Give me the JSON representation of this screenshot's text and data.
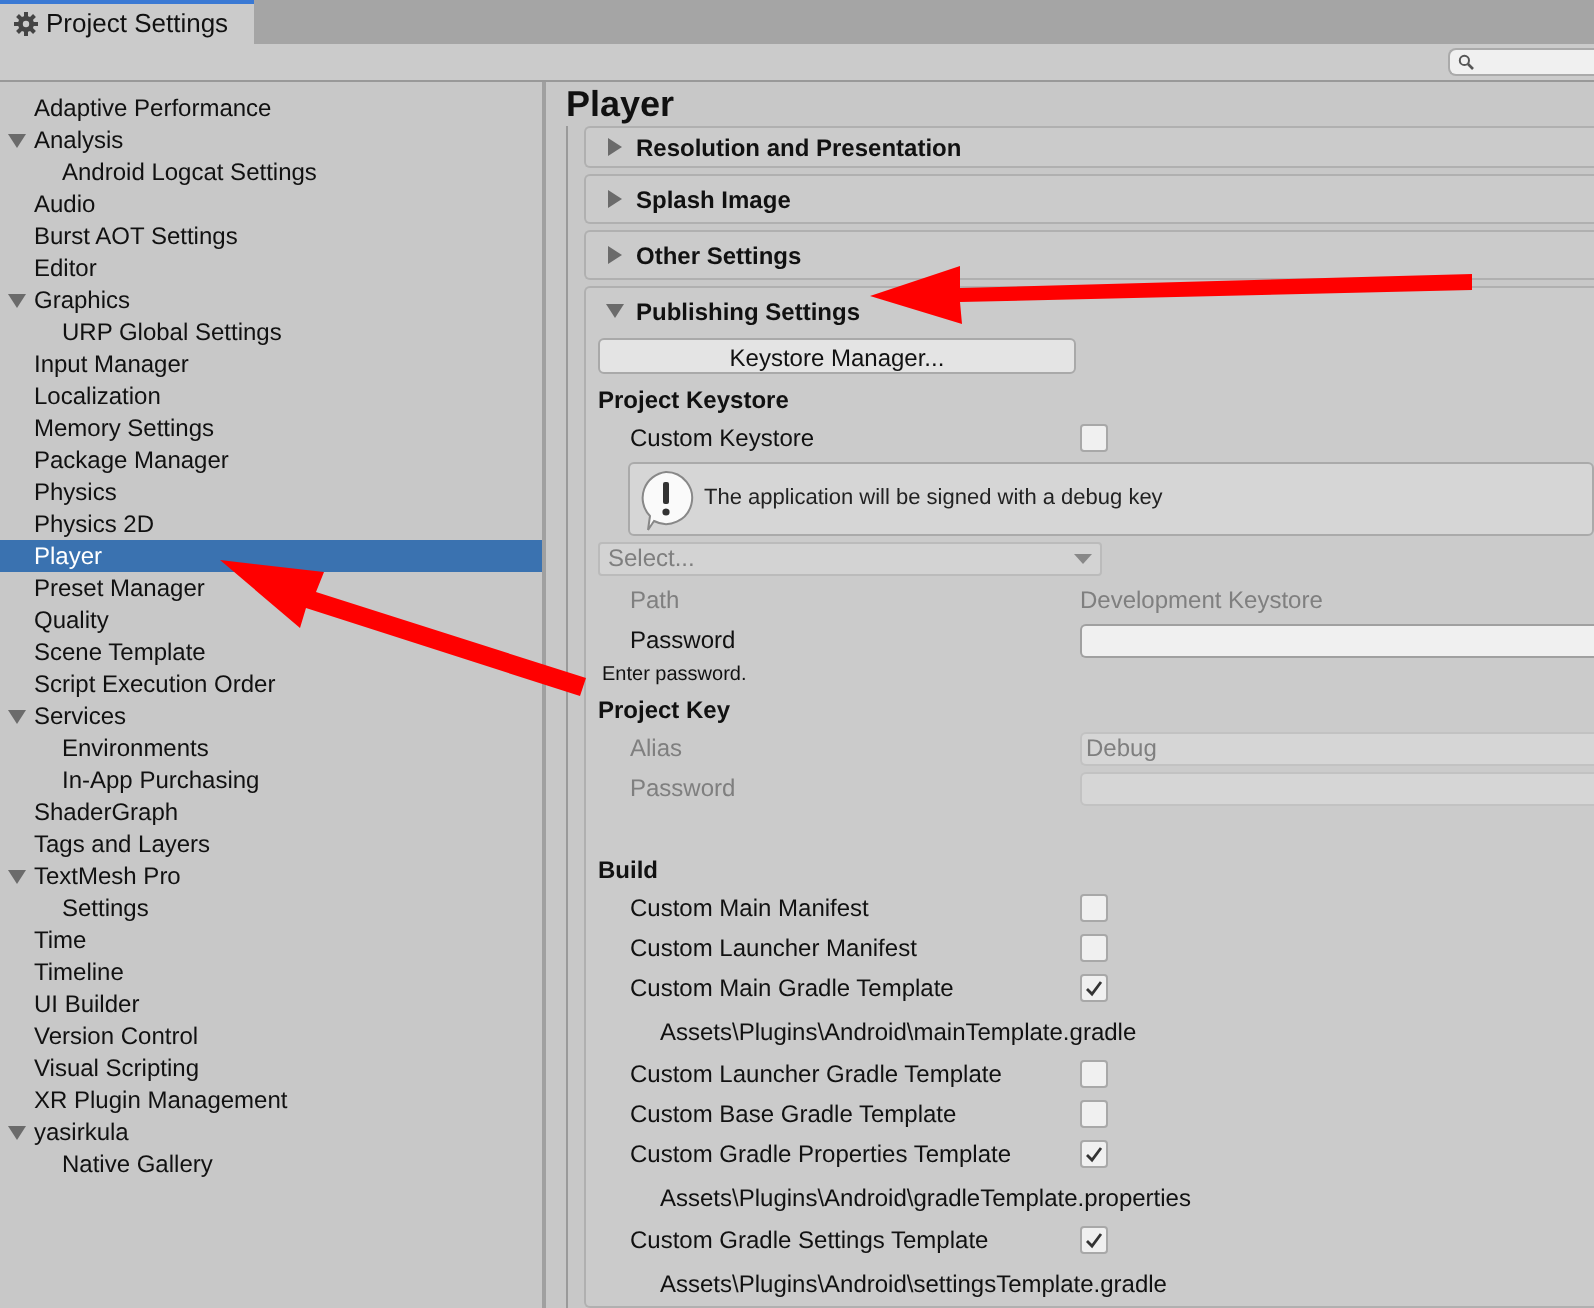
{
  "window": {
    "tab": "Project Settings"
  },
  "sidebar": {
    "items": [
      {
        "label": "Adaptive Performance",
        "selected": false
      },
      {
        "label": "Analysis",
        "selected": false,
        "expanded": true,
        "children": [
          {
            "label": "Android Logcat Settings",
            "selected": false
          }
        ]
      },
      {
        "label": "Audio",
        "selected": false
      },
      {
        "label": "Burst AOT Settings",
        "selected": false
      },
      {
        "label": "Editor",
        "selected": false
      },
      {
        "label": "Graphics",
        "selected": false,
        "expanded": true,
        "children": [
          {
            "label": "URP Global Settings",
            "selected": false
          }
        ]
      },
      {
        "label": "Input Manager",
        "selected": false
      },
      {
        "label": "Localization",
        "selected": false
      },
      {
        "label": "Memory Settings",
        "selected": false
      },
      {
        "label": "Package Manager",
        "selected": false
      },
      {
        "label": "Physics",
        "selected": false
      },
      {
        "label": "Physics 2D",
        "selected": false
      },
      {
        "label": "Player",
        "selected": true
      },
      {
        "label": "Preset Manager",
        "selected": false
      },
      {
        "label": "Quality",
        "selected": false
      },
      {
        "label": "Scene Template",
        "selected": false
      },
      {
        "label": "Script Execution Order",
        "selected": false
      },
      {
        "label": "Services",
        "selected": false,
        "expanded": true,
        "children": [
          {
            "label": "Environments",
            "selected": false
          },
          {
            "label": "In-App Purchasing",
            "selected": false
          }
        ]
      },
      {
        "label": "ShaderGraph",
        "selected": false
      },
      {
        "label": "Tags and Layers",
        "selected": false
      },
      {
        "label": "TextMesh Pro",
        "selected": false,
        "expanded": true,
        "children": [
          {
            "label": "Settings",
            "selected": false
          }
        ]
      },
      {
        "label": "Time",
        "selected": false
      },
      {
        "label": "Timeline",
        "selected": false
      },
      {
        "label": "UI Builder",
        "selected": false
      },
      {
        "label": "Version Control",
        "selected": false
      },
      {
        "label": "Visual Scripting",
        "selected": false
      },
      {
        "label": "XR Plugin Management",
        "selected": false
      },
      {
        "label": "yasirkula",
        "selected": false,
        "expanded": true,
        "children": [
          {
            "label": "Native Gallery",
            "selected": false
          }
        ]
      }
    ]
  },
  "panel": {
    "title": "Player",
    "foldouts": [
      {
        "title": "Resolution and Presentation",
        "expanded": false
      },
      {
        "title": "Splash Image",
        "expanded": false
      },
      {
        "title": "Other Settings",
        "expanded": false
      },
      {
        "title": "Publishing Settings",
        "expanded": true,
        "rows": [
          {
            "kind": "button",
            "label": "Keystore Manager..."
          },
          {
            "kind": "heading",
            "label": "Project Keystore"
          },
          {
            "kind": "checkbox",
            "label": "Custom Keystore",
            "checked": false
          },
          {
            "kind": "help",
            "label": "The application will be signed with a debug key"
          },
          {
            "kind": "dropdown",
            "placeholder": "Select...",
            "disabled": true
          },
          {
            "kind": "text",
            "label": "Path",
            "value": "Development Keystore",
            "disabled": true
          },
          {
            "kind": "field",
            "label": "Password",
            "disabled": false
          },
          {
            "kind": "note",
            "label": "Enter password."
          },
          {
            "kind": "heading",
            "label": "Project Key"
          },
          {
            "kind": "field",
            "label": "Alias",
            "value": "Debug",
            "disabled": true
          },
          {
            "kind": "field",
            "label": "Password",
            "disabled": true
          },
          {
            "kind": "spacer"
          },
          {
            "kind": "heading",
            "label": "Build"
          },
          {
            "kind": "checkbox",
            "label": "Custom Main Manifest",
            "checked": false
          },
          {
            "kind": "checkbox",
            "label": "Custom Launcher Manifest",
            "checked": false
          },
          {
            "kind": "checkbox",
            "label": "Custom Main Gradle Template",
            "checked": true
          },
          {
            "kind": "path",
            "label": "Assets\\Plugins\\Android\\mainTemplate.gradle"
          },
          {
            "kind": "checkbox",
            "label": "Custom Launcher Gradle Template",
            "checked": false
          },
          {
            "kind": "checkbox",
            "label": "Custom Base Gradle Template",
            "checked": false
          },
          {
            "kind": "checkbox",
            "label": "Custom Gradle Properties Template",
            "checked": true
          },
          {
            "kind": "path",
            "label": "Assets\\Plugins\\Android\\gradleTemplate.properties"
          },
          {
            "kind": "checkbox",
            "label": "Custom Gradle Settings Template",
            "checked": true
          },
          {
            "kind": "path",
            "label": "Assets\\Plugins\\Android\\settingsTemplate.gradle"
          }
        ]
      }
    ]
  }
}
